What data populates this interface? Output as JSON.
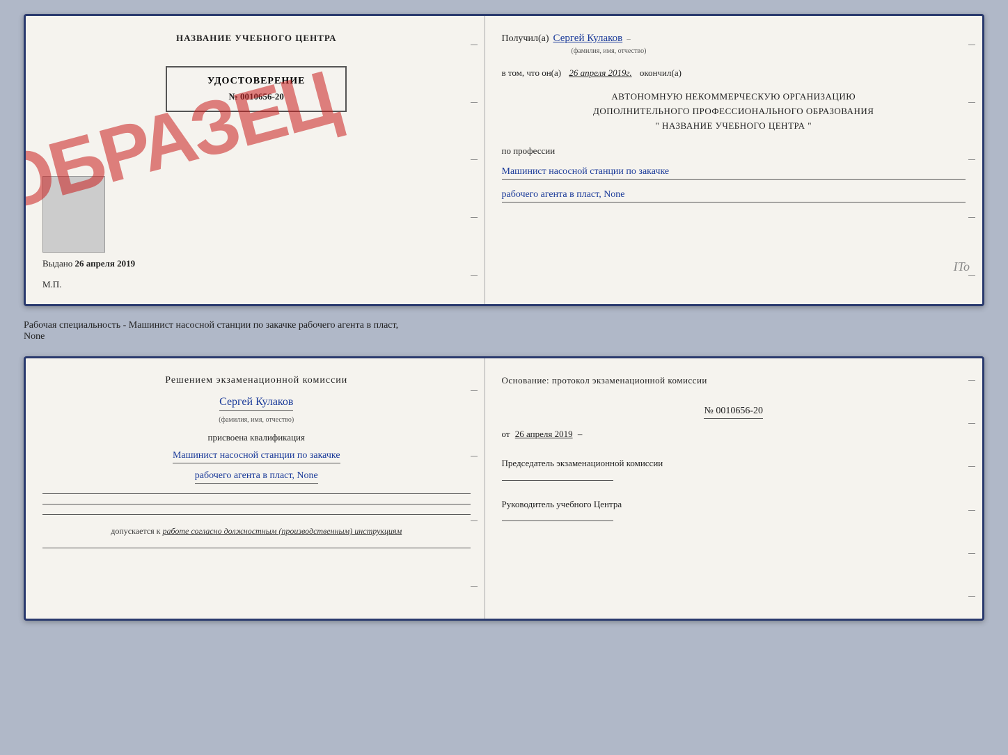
{
  "page1": {
    "left": {
      "school_title": "НАЗВАНИЕ УЧЕБНОГО ЦЕНТРА",
      "stamp": "ОБРАЗЕЦ",
      "cert_title": "УДОСТОВЕРЕНИЕ",
      "cert_number": "№ 0010656-20",
      "issued_label": "Выдано",
      "issued_date": "26 апреля 2019",
      "mp": "М.П."
    },
    "right": {
      "received_label": "Получил(а)",
      "received_name": "Сергей Кулаков",
      "name_hint": "(фамилия, имя, отчество)",
      "date_prefix": "в том, что он(а)",
      "date_value": "26 апреля 2019г.",
      "date_suffix": "окончил(а)",
      "org_line1": "АВТОНОМНУЮ НЕКОММЕРЧЕСКУЮ ОРГАНИЗАЦИЮ",
      "org_line2": "ДОПОЛНИТЕЛЬНОГО ПРОФЕССИОНАЛЬНОГО ОБРАЗОВАНИЯ",
      "org_line3": "\" НАЗВАНИЕ УЧЕБНОГО ЦЕНТРА \"",
      "profession_label": "по профессии",
      "profession_line1": "Машинист насосной станции по закачке",
      "profession_line2": "рабочего агента в пласт, None"
    }
  },
  "middle_text": "Рабочая специальность - Машинист насосной станции по закачке рабочего агента в пласт,",
  "middle_text2": "None",
  "page2": {
    "left": {
      "commission_title": "Решением экзаменационной комиссии",
      "name_handwritten": "Сергей Кулаков",
      "name_hint": "(фамилия, имя, отчество)",
      "qualification_label": "присвоена квалификация",
      "qualification_line1": "Машинист насосной станции по закачке",
      "qualification_line2": "рабочего агента в пласт, None",
      "allowed_prefix": "допускается к",
      "allowed_text": "работе согласно должностным (производственным) инструкциям"
    },
    "right": {
      "basis_title": "Основание: протокол экзаменационной комиссии",
      "protocol_number": "№ 0010656-20",
      "protocol_date_prefix": "от",
      "protocol_date": "26 апреля 2019",
      "chairman_label": "Председатель экзаменационной комиссии",
      "director_label": "Руководитель учебного Центра"
    }
  }
}
